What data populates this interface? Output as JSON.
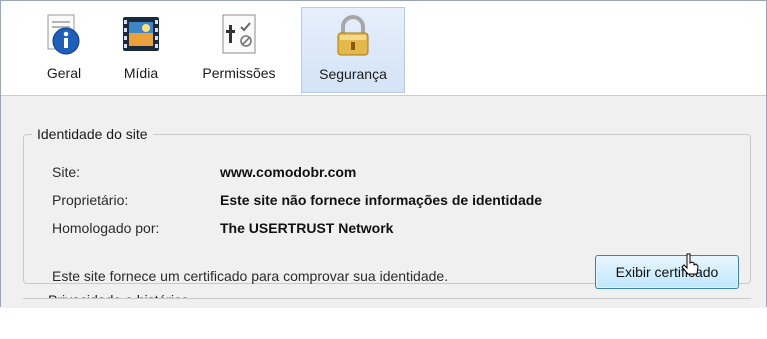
{
  "toolbar": {
    "tabs": [
      {
        "label": "Geral",
        "icon": "info-icon"
      },
      {
        "label": "Mídia",
        "icon": "media-icon"
      },
      {
        "label": "Permissões",
        "icon": "permissions-icon"
      },
      {
        "label": "Segurança",
        "icon": "padlock-icon",
        "active": true
      }
    ]
  },
  "identity": {
    "title": "Identidade do site",
    "site_label": "Site:",
    "site_value": "www.comodobr.com",
    "owner_label": "Proprietário:",
    "owner_value": "Este site não fornece informações de identidade",
    "verified_label": "Homologado por:",
    "verified_value": "The USERTRUST Network",
    "note": "Este site fornece um certificado para comprovar sua identidade.",
    "button_label": "Exibir certificado"
  },
  "next_section": {
    "title": "Privacidade e histórico"
  },
  "colors": {
    "active_tab": "#d4e3f6",
    "button_border": "#3c7fb1",
    "group_border": "#c9c9c9"
  }
}
